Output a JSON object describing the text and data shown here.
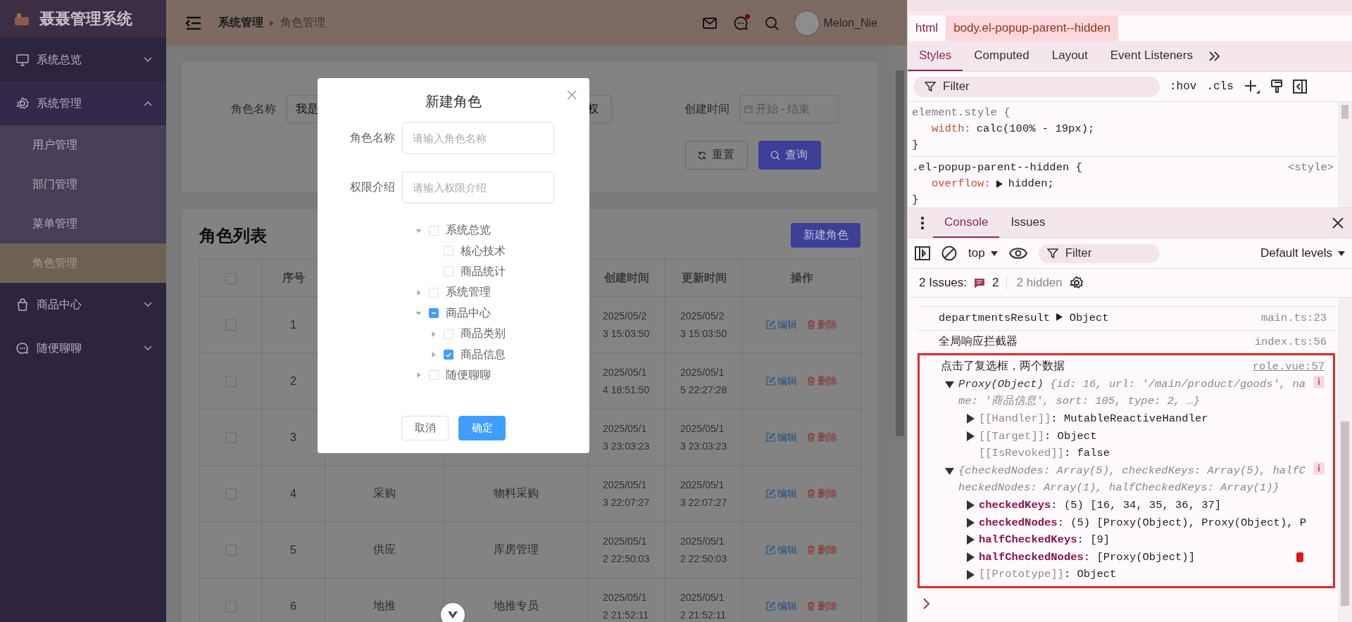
{
  "sidebar": {
    "logo": "聂聂管理系统",
    "menu": [
      {
        "label": "系统总览",
        "expanded": false
      },
      {
        "label": "系统管理",
        "expanded": true,
        "children": [
          {
            "label": "用户管理",
            "selected": false
          },
          {
            "label": "部门管理",
            "selected": false
          },
          {
            "label": "菜单管理",
            "selected": false
          },
          {
            "label": "角色管理",
            "selected": true
          }
        ]
      },
      {
        "label": "商品中心",
        "expanded": false
      },
      {
        "label": "随便聊聊",
        "expanded": false
      }
    ]
  },
  "header": {
    "breadcrumb": [
      "系统管理",
      "角色管理"
    ],
    "unread": true,
    "username": "Melon_Nie"
  },
  "search_form": {
    "name_field": {
      "label": "角色名称",
      "value": "我是"
    },
    "description_field": {
      "value": "权"
    },
    "date_field": {
      "label": "创建时间",
      "start": "开始",
      "separator": "-",
      "end": "结束"
    },
    "buttons": [
      {
        "label": "重置",
        "kind": "reset"
      },
      {
        "label": "查询",
        "kind": "search"
      }
    ]
  },
  "role_table": {
    "title": "角色列表",
    "create_button": "新建角色",
    "select_all": false,
    "columns": {
      "number": "序号",
      "created": "创建时间",
      "updated": "更新时间",
      "actions": "操作"
    },
    "rows": [
      {
        "selected": false,
        "number": "1",
        "created": "2025/05/23 15:03:50",
        "updated": "2025/05/23 15:03:50",
        "edit": "编辑",
        "delete": "删除"
      },
      {
        "selected": false,
        "number": "2",
        "created": "2025/05/14 18:51:50",
        "updated": "2025/05/15 22:27:28",
        "edit": "编辑",
        "delete": "删除"
      },
      {
        "selected": false,
        "number": "3",
        "created": "2025/05/13 23:03:23",
        "updated": "2025/05/13 23:03:23",
        "edit": "编辑",
        "delete": "删除"
      },
      {
        "selected": false,
        "number": "4",
        "name": "采购",
        "description": "物料采购",
        "created": "2025/05/13 22:07:27",
        "updated": "2025/05/13 22:07:27",
        "edit": "编辑",
        "delete": "删除"
      },
      {
        "selected": false,
        "number": "5",
        "name": "供应",
        "description": "库房管理",
        "created": "2025/05/12 22:50:03",
        "updated": "2025/05/12 22:50:03",
        "edit": "编辑",
        "delete": "删除"
      },
      {
        "selected": false,
        "number": "6",
        "name": "地推",
        "description": "地推专员",
        "created": "2025/05/12 21:52:11",
        "updated": "2025/05/12 21:52:11",
        "edit": "编辑",
        "delete": "删除"
      }
    ]
  },
  "modal": {
    "title": "新建角色",
    "fields": [
      {
        "label": "角色名称",
        "placeholder": "请输入角色名称"
      },
      {
        "label": "权限介绍",
        "placeholder": "请输入权限介绍"
      }
    ],
    "tree": [
      {
        "label": "系统总览",
        "checked": false,
        "expanded": true,
        "children": [
          {
            "label": "核心技术",
            "checked": false
          },
          {
            "label": "商品统计",
            "checked": false
          }
        ]
      },
      {
        "label": "系统管理",
        "checked": false,
        "expanded": false
      },
      {
        "label": "商品中心",
        "indeterminate": true,
        "expanded": true,
        "children": [
          {
            "label": "商品类别",
            "checked": false,
            "expanded": false
          },
          {
            "label": "商品信息",
            "checked": true,
            "expanded": false
          }
        ]
      },
      {
        "label": "随便聊聊",
        "checked": false,
        "expanded": false
      }
    ],
    "buttons": [
      {
        "label": "取消",
        "kind": "secondary"
      },
      {
        "label": "确定",
        "kind": "primary"
      }
    ]
  },
  "devtools": {
    "breadcrumb": [
      {
        "label": "html",
        "selected": false
      },
      {
        "label": "body.el-popup-parent--hidden",
        "selected": true
      }
    ],
    "tabs": [
      {
        "label": "Styles",
        "selected": true
      },
      {
        "label": "Computed",
        "selected": false
      },
      {
        "label": "Layout",
        "selected": false
      },
      {
        "label": "Event Listeners",
        "selected": false
      }
    ],
    "styles_filter": "Filter",
    "toggles": [
      ":hov",
      ".cls"
    ],
    "rules": [
      {
        "selector": "element.style",
        "open": "{",
        "close": "}",
        "declarations": [
          {
            "property": "width:",
            "value": "calc(100% - 19px);"
          }
        ]
      },
      {
        "selector": ".el-popup-parent--hidden",
        "open": "{",
        "close": "}",
        "source": "<style>",
        "declarations": [
          {
            "property": "overflow:",
            "value": "hidden;",
            "expandable": true
          }
        ]
      }
    ],
    "drawer_tabs": [
      {
        "label": "Console",
        "selected": true
      },
      {
        "label": "Issues",
        "selected": false
      }
    ],
    "context": "top",
    "console_filter": "Filter",
    "levels": "Default levels",
    "issues": {
      "label": "2 Issues:",
      "count": "2",
      "hidden": "2 hidden"
    },
    "messages": [
      {
        "text": "departmentsResult",
        "object": "Object",
        "source": "main.ts:23",
        "highlighted": false
      },
      {
        "text": "全局响应拦截器",
        "source": "index.ts:56",
        "highlighted": false
      },
      {
        "text": "点击了复选框，两个数据",
        "source": "role.vue:57",
        "highlighted": true,
        "entries": [
          {
            "label": "Proxy(Object)",
            "text": "{id: 16, url: '/main/product/goods', name: '商品信息', sort: 105, type: 2,  …}",
            "expanded": true,
            "children": [
              {
                "kind": "internal",
                "key": "[[Handler]]",
                "value": ": MutableReactiveHandler",
                "expandable": true
              },
              {
                "kind": "internal",
                "key": "[[Target]]",
                "value": ": Object",
                "expandable": true
              },
              {
                "kind": "internal",
                "key": "[[IsRevoked]]",
                "value": ": false",
                "expandable": false
              }
            ]
          },
          {
            "text": "{checkedNodes: Array(5), checkedKeys: Array(5), halfCheckedNodes: Array(1), halfCheckedKeys: Array(1)}",
            "expanded": true,
            "children": [
              {
                "kind": "property",
                "key": "checkedKeys",
                "value": ": (5)  [16, 34, 35, 36, 37]",
                "expandable": true
              },
              {
                "kind": "property",
                "key": "checkedNodes",
                "value": ": (5)  [Proxy(Object), Proxy(Object), P",
                "expandable": true
              },
              {
                "kind": "property",
                "key": "halfCheckedKeys",
                "value": ": [9]",
                "expandable": true
              },
              {
                "kind": "property",
                "key": "halfCheckedNodes",
                "value": ": [Proxy(Object)]",
                "expandable": true,
                "marker": true
              },
              {
                "kind": "internal",
                "key": "[[Prototype]]",
                "value": ": Object",
                "expandable": true
              }
            ]
          }
        ]
      }
    ]
  }
}
